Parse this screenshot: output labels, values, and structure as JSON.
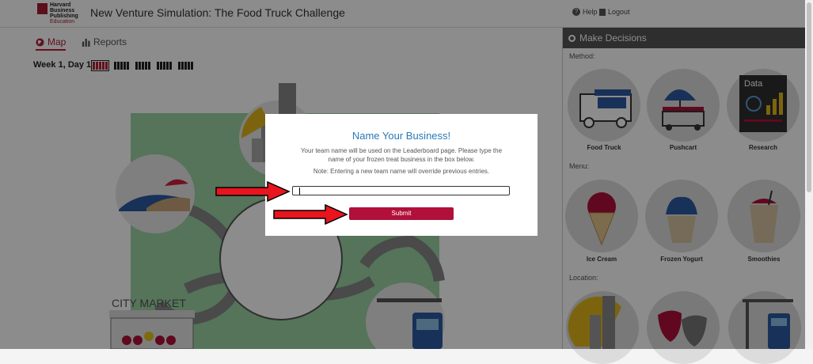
{
  "header": {
    "logo_lines": [
      "Harvard",
      "Business",
      "Publishing"
    ],
    "logo_sub": "Education",
    "title": "New Venture Simulation: The Food Truck Challenge",
    "help_label": "Help",
    "logout_label": "Logout"
  },
  "tabs": [
    {
      "label": "Map",
      "icon": "globe-icon",
      "active": true
    },
    {
      "label": "Reports",
      "icon": "bar-chart-icon",
      "active": false
    }
  ],
  "timeline": {
    "label": "Week 1, Day 1",
    "weeks": 5,
    "days_per_week": 5,
    "current_week": 1
  },
  "map": {
    "city_market_label": "CITY MARKET"
  },
  "panel": {
    "title": "Make Decisions",
    "method_label": "Method:",
    "menu_label": "Menu:",
    "location_label": "Location:",
    "method_options": [
      "Food Truck",
      "Pushcart",
      "Research"
    ],
    "menu_options": [
      "Ice Cream",
      "Frozen Yogurt",
      "Smoothies"
    ],
    "research_card_label": "Data"
  },
  "modal": {
    "title": "Name Your Business!",
    "body_line1": "Your team name will be used on the Leaderboard page. Please type the",
    "body_line2": "name of your frozen treat business in the box below.",
    "note": "Note: Entering a new team name will override previous entries.",
    "input_value": "",
    "submit_label": "Submit"
  },
  "colors": {
    "accent": "#b0103a",
    "title_blue": "#2a78b6",
    "arrow_red": "#e8141e"
  }
}
